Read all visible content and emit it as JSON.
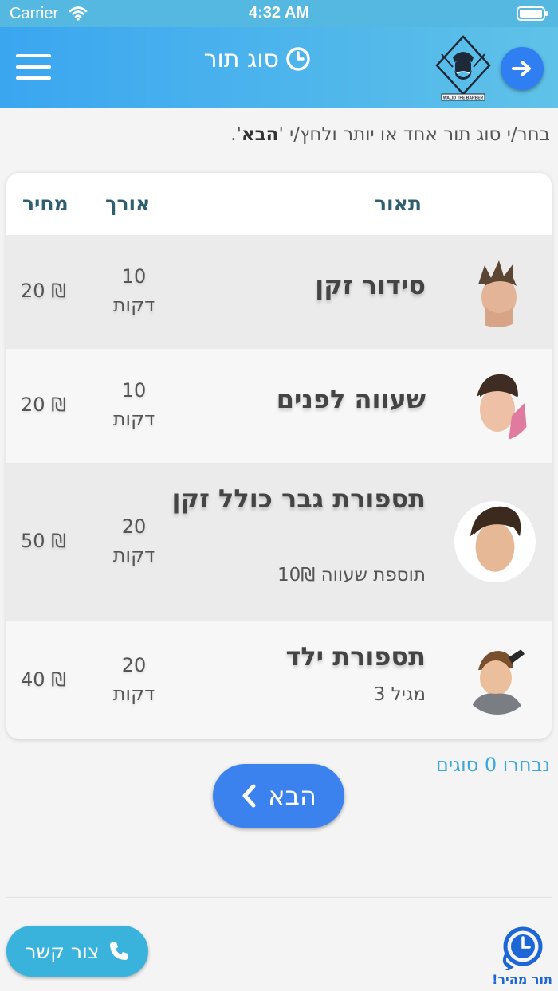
{
  "status_bar": {
    "carrier": "Carrier",
    "time": "4:32 AM"
  },
  "header": {
    "title": "סוג תור",
    "logo_text": "WALID THE BARBER"
  },
  "instruction": {
    "text": "בחר/י סוג תור אחד או יותר ולחץ/י '",
    "emphasis": "הבא",
    "suffix": "'."
  },
  "table": {
    "headers": {
      "description": "תאור",
      "length": "אורך",
      "price": "מחיר"
    },
    "rows": [
      {
        "name": "סידור זקן",
        "subtitle": "",
        "length": "10",
        "length_unit": "דקות",
        "price": "20 ₪",
        "avatar": "man-spiky-hair-icon"
      },
      {
        "name": "שעווה לפנים",
        "subtitle": "",
        "length": "10",
        "length_unit": "דקות",
        "price": "20 ₪",
        "avatar": "man-styled-hair-icon"
      },
      {
        "name": "תספורת גבר כולל זקן",
        "subtitle": "תוספת שעווה 10₪",
        "length": "20",
        "length_unit": "דקות",
        "price": "50 ₪",
        "avatar": "man-brown-hair-icon"
      },
      {
        "name": "תספורת ילד",
        "subtitle": "מגיל 3",
        "length": "20",
        "length_unit": "דקות",
        "price": "40 ₪",
        "avatar": "boy-haircut-icon"
      }
    ]
  },
  "selected_count": "נבחרו 0 סוגים",
  "next_button": {
    "label": "הבא"
  },
  "contact_button": {
    "label": "צור קשר"
  },
  "quick_queue": {
    "label": "תור מהיר!"
  },
  "colors": {
    "header_start": "#3aa6f0",
    "header_end": "#5fc2e8",
    "primary_button": "#3b82ef",
    "contact_button": "#3ab3dc"
  }
}
